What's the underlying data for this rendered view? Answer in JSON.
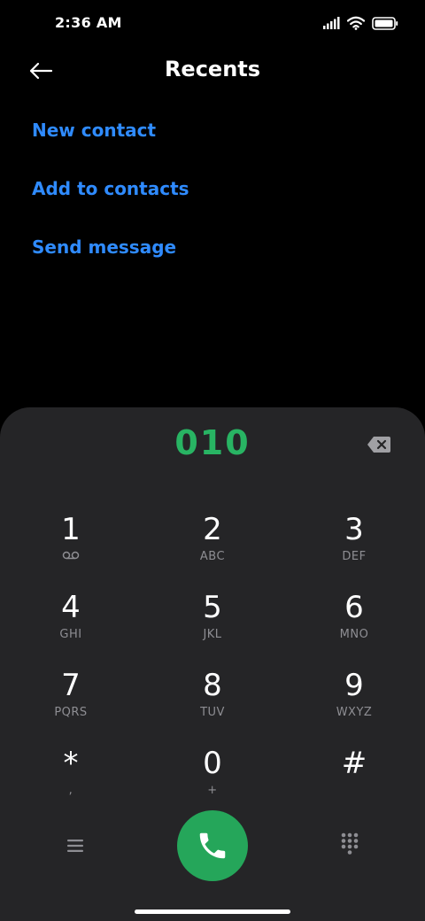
{
  "status_bar": {
    "time": "2:36 AM",
    "icons": [
      "signal-icon",
      "wifi-icon",
      "battery-icon"
    ]
  },
  "header": {
    "back_icon": "back-arrow-icon",
    "title": "Recents"
  },
  "actions": [
    {
      "label": "New contact"
    },
    {
      "label": "Add to contacts"
    },
    {
      "label": "Send message"
    }
  ],
  "dialer": {
    "number": "010",
    "backspace_icon": "backspace-icon",
    "keys": [
      {
        "digit": "1",
        "sub_icon": "voicemail-icon"
      },
      {
        "digit": "2",
        "letters": "ABC"
      },
      {
        "digit": "3",
        "letters": "DEF"
      },
      {
        "digit": "4",
        "letters": "GHI"
      },
      {
        "digit": "5",
        "letters": "JKL"
      },
      {
        "digit": "6",
        "letters": "MNO"
      },
      {
        "digit": "7",
        "letters": "PQRS"
      },
      {
        "digit": "8",
        "letters": "TUV"
      },
      {
        "digit": "9",
        "letters": "WXYZ"
      },
      {
        "digit": "*",
        "letters": ","
      },
      {
        "digit": "0",
        "letters": "+"
      },
      {
        "digit": "#",
        "letters": ""
      }
    ],
    "bottom": {
      "menu_icon": "menu-icon",
      "call_icon": "phone-icon",
      "keypad_icon": "dialpad-icon"
    }
  },
  "colors": {
    "background": "#000000",
    "link": "#2f8bff",
    "dialer_bg": "#252527",
    "number": "#28b463",
    "call_button": "#25a65a",
    "secondary_text": "#8e8e93"
  }
}
